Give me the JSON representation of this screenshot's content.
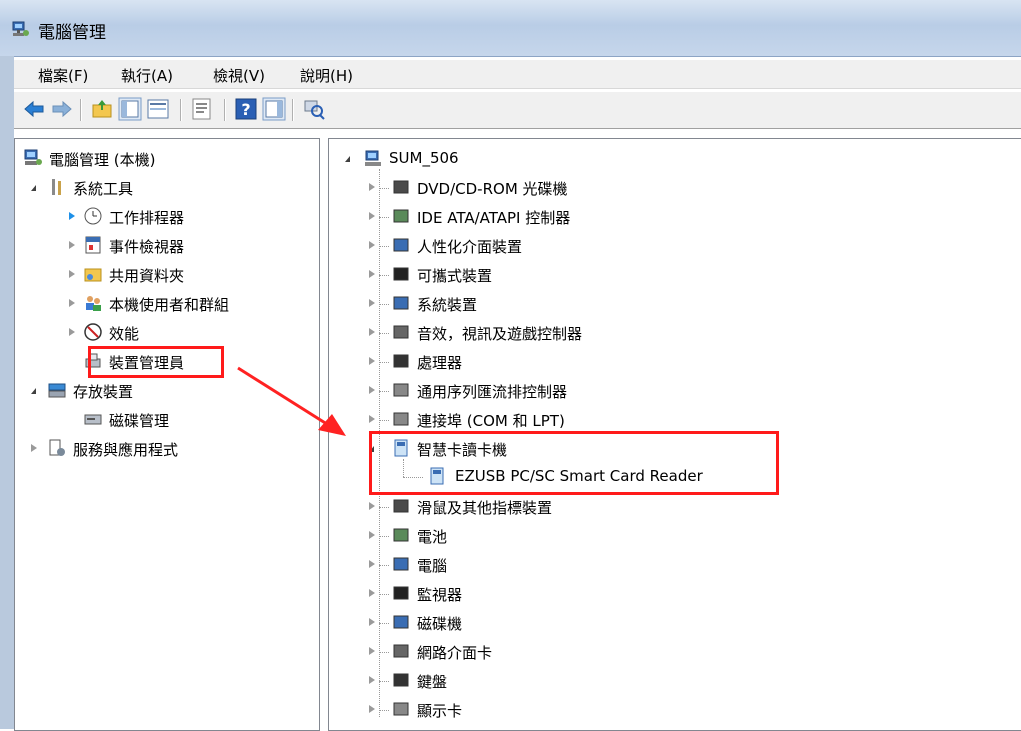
{
  "window": {
    "title": "電腦管理"
  },
  "menu": [
    "檔案(F)",
    "執行(A)",
    "檢視(V)",
    "說明(H)"
  ],
  "toolbar": [
    {
      "icon": "back-arrow-icon"
    },
    {
      "icon": "forward-arrow-icon"
    },
    {
      "icon": "up-folder-icon"
    },
    {
      "icon": "show-hide-tree-icon"
    },
    {
      "icon": "properties-icon"
    },
    {
      "icon": "help-icon"
    },
    {
      "icon": "action-pane-icon"
    },
    {
      "icon": "scan-hardware-icon"
    }
  ],
  "left_tree": {
    "root": "電腦管理 (本機)",
    "system_tools": "系統工具",
    "system_items": [
      "工作排程器",
      "事件檢視器",
      "共用資料夾",
      "本機使用者和群組",
      "效能",
      "裝置管理員"
    ],
    "storage": "存放裝置",
    "storage_items": [
      "磁碟管理"
    ],
    "services": "服務與應用程式"
  },
  "right_tree": {
    "root": "SUM_506",
    "items_before": [
      "DVD/CD-ROM 光碟機",
      "IDE ATA/ATAPI 控制器",
      "人性化介面裝置",
      "可攜式裝置",
      "系統裝置",
      "音效，視訊及遊戲控制器",
      "處理器",
      "通用序列匯流排控制器",
      "連接埠 (COM 和 LPT)"
    ],
    "expanded": "智慧卡讀卡機",
    "child": "EZUSB PC/SC Smart Card Reader",
    "items_after": [
      "滑鼠及其他指標裝置",
      "電池",
      "電腦",
      "監視器",
      "磁碟機",
      "網路介面卡",
      "鍵盤",
      "顯示卡"
    ]
  },
  "colors": {
    "highlight": "#ff1a1a",
    "accent_arrow": "#1e90e8"
  }
}
